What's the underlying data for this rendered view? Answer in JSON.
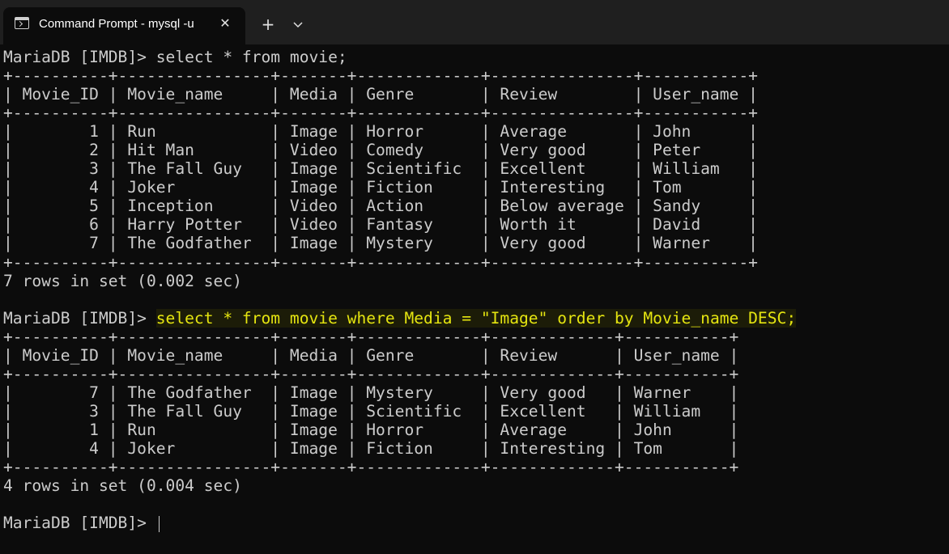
{
  "tab": {
    "title": "Command Prompt - mysql  -u",
    "icon": "terminal-icon",
    "close_icon": "close-icon",
    "new_tab_icon": "plus-icon",
    "dropdown_icon": "chevron-down-icon"
  },
  "colors": {
    "background": "#0c0c0c",
    "tabbar": "#1f1f1f",
    "text": "#cccccc",
    "highlighted_command": "#e5e510"
  },
  "terminal": {
    "prompt": "MariaDB [IMDB]> ",
    "cmd1": "select * from movie;",
    "table1": {
      "border": "+----------+----------------+-------+-------------+---------------+-----------+",
      "header": "| Movie_ID | Movie_name     | Media | Genre       | Review        | User_name |",
      "rows": [
        "|        1 | Run            | Image | Horror      | Average       | John      |",
        "|        2 | Hit Man        | Video | Comedy      | Very good     | Peter     |",
        "|        3 | The Fall Guy   | Image | Scientific  | Excellent     | William   |",
        "|        4 | Joker          | Image | Fiction     | Interesting   | Tom       |",
        "|        5 | Inception      | Video | Action      | Below average | Sandy     |",
        "|        6 | Harry Potter   | Video | Fantasy     | Worth it      | David     |",
        "|        7 | The Godfather  | Image | Mystery     | Very good     | Warner    |"
      ]
    },
    "result1": "7 rows in set (0.002 sec)",
    "cmd2": "select * from movie where Media = \"Image\" order by Movie_name DESC;",
    "table2": {
      "border": "+----------+----------------+-------+-------------+-------------+-----------+",
      "header": "| Movie_ID | Movie_name     | Media | Genre       | Review      | User_name |",
      "rows": [
        "|        7 | The Godfather  | Image | Mystery     | Very good   | Warner    |",
        "|        3 | The Fall Guy   | Image | Scientific  | Excellent   | William   |",
        "|        1 | Run            | Image | Horror      | Average     | John      |",
        "|        4 | Joker          | Image | Fiction     | Interesting | Tom       |"
      ]
    },
    "result2": "4 rows in set (0.004 sec)"
  }
}
